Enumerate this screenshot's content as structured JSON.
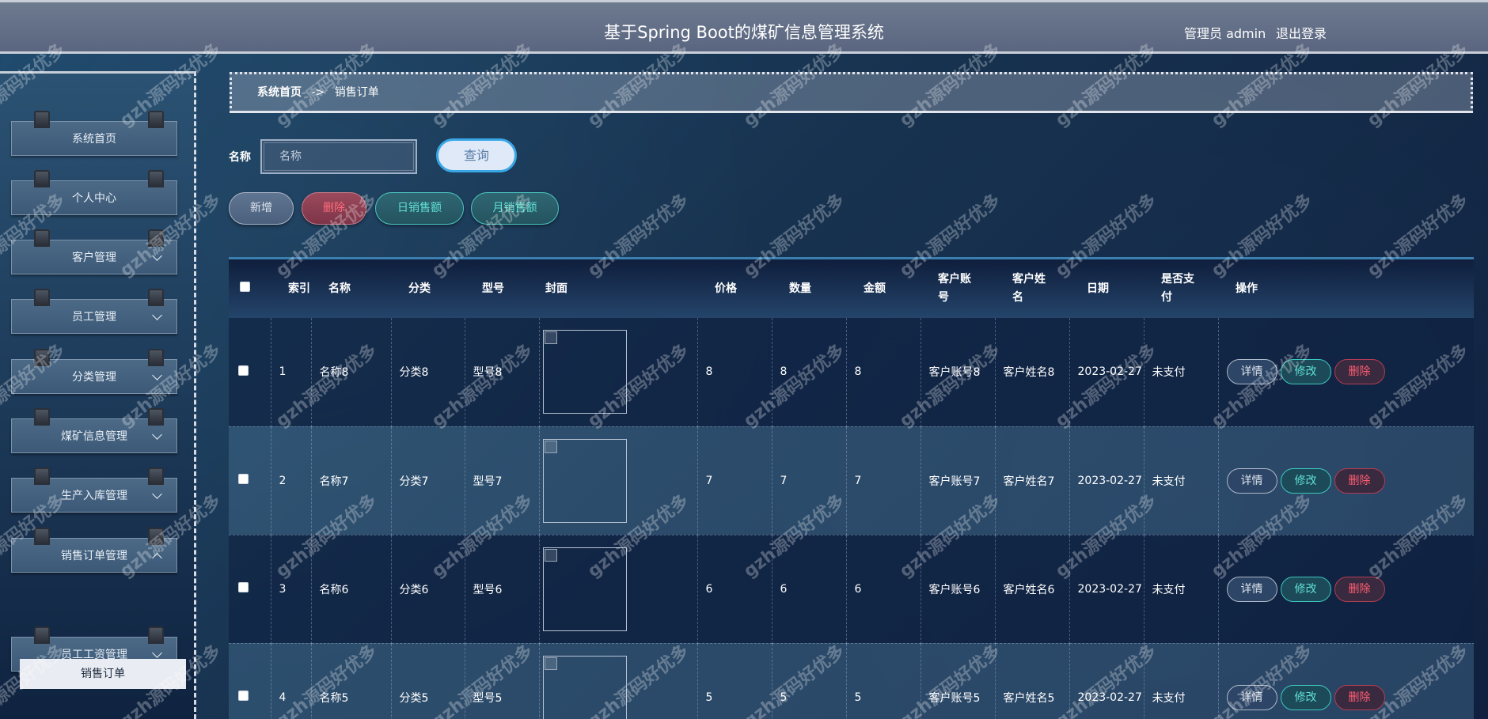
{
  "header": {
    "title": "基于Spring Boot的煤矿信息管理系统",
    "user": "管理员 admin",
    "logout": "退出登录"
  },
  "sidebar": {
    "items": [
      {
        "label": "系统首页",
        "expandable": false
      },
      {
        "label": "个人中心",
        "expandable": false
      },
      {
        "label": "客户管理",
        "expandable": true
      },
      {
        "label": "员工管理",
        "expandable": true
      },
      {
        "label": "分类管理",
        "expandable": true
      },
      {
        "label": "煤矿信息管理",
        "expandable": true
      },
      {
        "label": "生产入库管理",
        "expandable": true
      },
      {
        "label": "销售订单管理",
        "expandable": true,
        "expanded": true
      },
      {
        "label": "员工工资管理",
        "expandable": true
      }
    ],
    "active_subitem": "销售订单"
  },
  "breadcrumb": {
    "home": "系统首页",
    "separator": "->",
    "current": "销售订单"
  },
  "search": {
    "label": "名称",
    "placeholder": "名称",
    "value": "",
    "button": "查询"
  },
  "actions": {
    "new": "新增",
    "delete": "删除",
    "daily_sales": "日销售额",
    "monthly_sales": "月销售额"
  },
  "table": {
    "headers": {
      "index": "索引",
      "name": "名称",
      "category": "分类",
      "model": "型号",
      "cover": "封面",
      "price": "价格",
      "quantity": "数量",
      "amount": "金额",
      "customer_account": "客户账号",
      "customer_name": "客户姓名",
      "date": "日期",
      "paid": "是否支付",
      "operation": "操作"
    },
    "rows": [
      {
        "index": "1",
        "name": "名称8",
        "category": "分类8",
        "model": "型号8",
        "price": "8",
        "quantity": "8",
        "amount": "8",
        "customer_account": "客户账号8",
        "customer_name": "客户姓名8",
        "date": "2023-02-27",
        "paid": "未支付"
      },
      {
        "index": "2",
        "name": "名称7",
        "category": "分类7",
        "model": "型号7",
        "price": "7",
        "quantity": "7",
        "amount": "7",
        "customer_account": "客户账号7",
        "customer_name": "客户姓名7",
        "date": "2023-02-27",
        "paid": "未支付"
      },
      {
        "index": "3",
        "name": "名称6",
        "category": "分类6",
        "model": "型号6",
        "price": "6",
        "quantity": "6",
        "amount": "6",
        "customer_account": "客户账号6",
        "customer_name": "客户姓名6",
        "date": "2023-02-27",
        "paid": "未支付"
      },
      {
        "index": "4",
        "name": "名称5",
        "category": "分类5",
        "model": "型号5",
        "price": "5",
        "quantity": "5",
        "amount": "5",
        "customer_account": "客户账号5",
        "customer_name": "客户姓名5",
        "date": "2023-02-27",
        "paid": "未支付"
      }
    ],
    "row_actions": {
      "detail": "详情",
      "edit": "修改",
      "delete": "删除"
    }
  },
  "watermark": "gzh源码好优多"
}
